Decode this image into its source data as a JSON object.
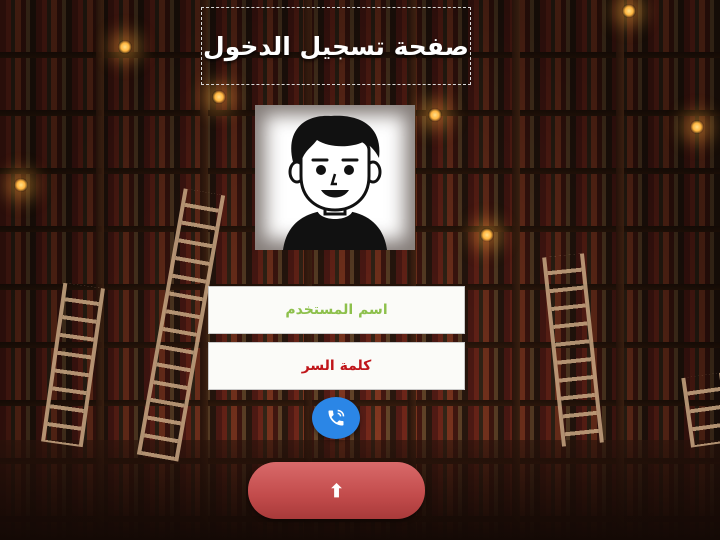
{
  "page": {
    "title": "صفحة تسجيل الدخول"
  },
  "form": {
    "username_placeholder": "اسم المستخدم",
    "password_placeholder": "كلمة السر",
    "submit_arrow": "⬆"
  },
  "icons": {
    "avatar": "user-avatar-icon",
    "call": "phone-icon",
    "submit": "arrow-up-icon"
  },
  "colors": {
    "username_placeholder": "#8dc04c",
    "password_placeholder": "#c0161a",
    "call_button": "#2b86e6",
    "submit_button": "#c24b4b"
  }
}
